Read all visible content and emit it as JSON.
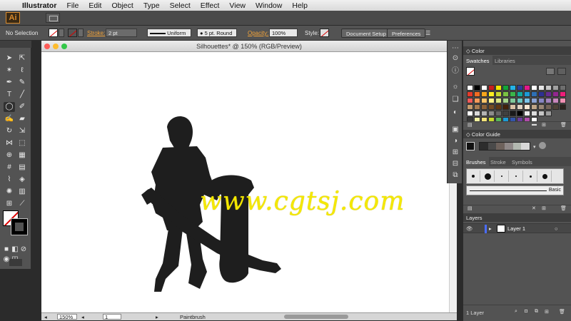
{
  "menubar": {
    "apple": "",
    "items": [
      "Illustrator",
      "File",
      "Edit",
      "Object",
      "Type",
      "Select",
      "Effect",
      "View",
      "Window",
      "Help"
    ]
  },
  "appbar": {
    "logo": "Ai"
  },
  "control_bar": {
    "selection_label": "No Selection",
    "stroke_label": "Stroke:",
    "stroke_weight": "2 pt",
    "profile": "Uniform",
    "brush": "5 pt. Round",
    "opacity_label": "Opacity:",
    "opacity_value": "100%",
    "style_label": "Style:",
    "document_setup_button": "Document Setup",
    "preferences_button": "Preferences"
  },
  "document": {
    "title": "Silhouettes* @ 150% (RGB/Preview)",
    "zoom": "150%",
    "artboard": "1",
    "current_tool": "Paintbrush",
    "watermark": "www.cgtsj.com"
  },
  "panels": {
    "color": {
      "title": "Color"
    },
    "swatches": {
      "tabs": [
        "Swatches",
        "Libraries"
      ]
    },
    "color_guide": {
      "title": "Color Guide"
    },
    "brushes": {
      "tabs": [
        "Brushes",
        "Stroke",
        "Symbols"
      ],
      "basic_label": "Basic"
    },
    "layers": {
      "title": "Layers",
      "layer_name": "Layer 1",
      "footer_count": "1 Layer"
    }
  },
  "colors": {
    "silhouette": "#1e1e1e",
    "watermark": "#f4e800",
    "ui_panel": "#535353",
    "stroke_link": "#f2a33a",
    "layer_color": "#4a6cff"
  }
}
